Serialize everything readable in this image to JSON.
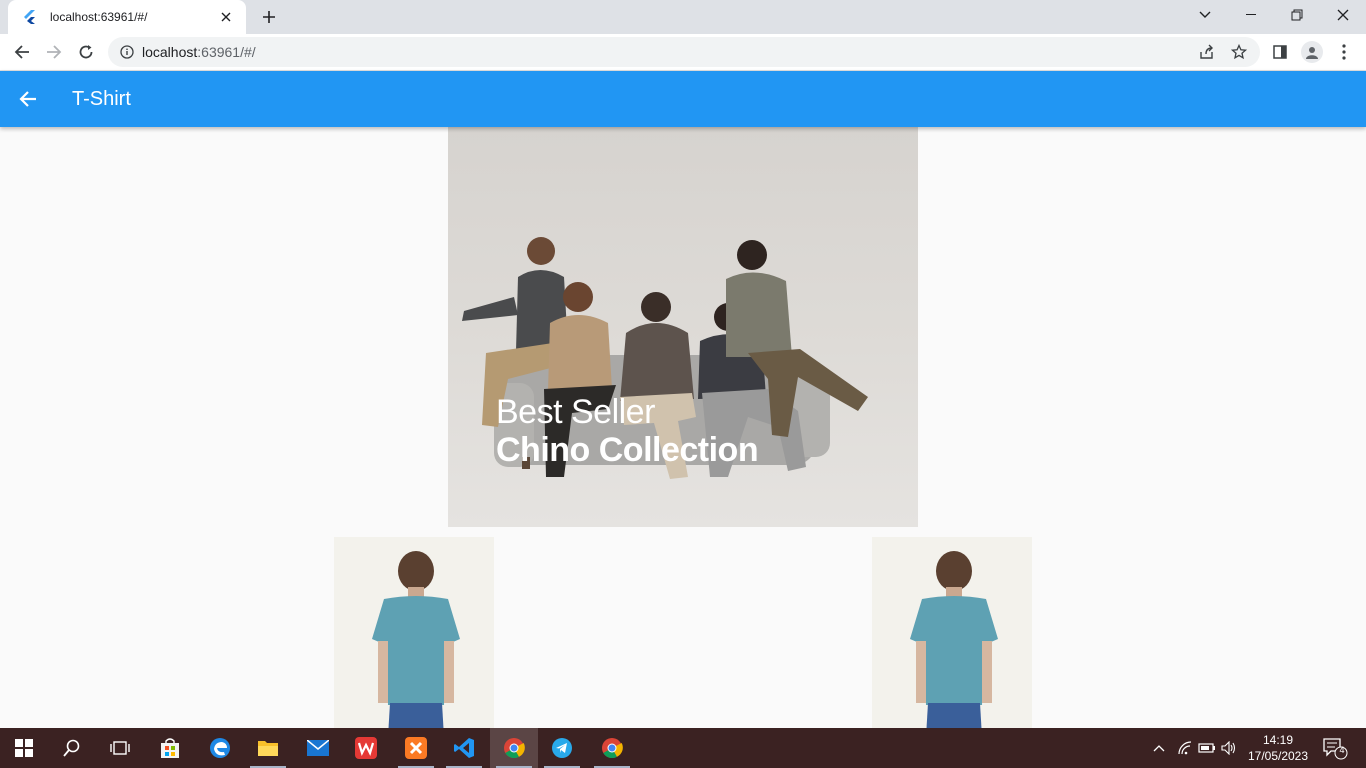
{
  "browser": {
    "tab_title": "localhost:63961/#/",
    "url_host": "localhost",
    "url_rest": ":63961/#/"
  },
  "app": {
    "title": "T-Shirt"
  },
  "banner": {
    "line1": "Best Seller",
    "line2": "Chino Collection"
  },
  "taskbar": {
    "time": "14:19",
    "date": "17/05/2023",
    "notification_count": "4"
  },
  "colors": {
    "app_bar": "#2196f3",
    "taskbar": "#3b2222",
    "shirt": "#5ea1b3"
  }
}
